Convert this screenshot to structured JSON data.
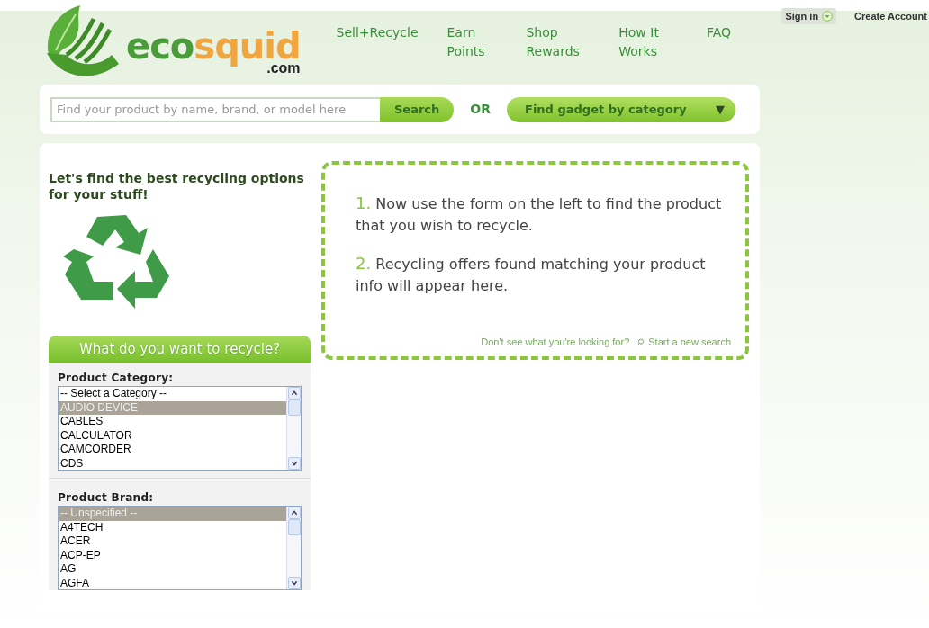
{
  "account": {
    "sign_in": "Sign in",
    "create_account": "Create Account"
  },
  "logo": {
    "word_first": "eco",
    "word_second": "squid",
    "domain": ".com"
  },
  "nav": [
    {
      "label": "Sell+Recycle"
    },
    {
      "label": "Earn Points"
    },
    {
      "label": "Shop Rewards"
    },
    {
      "label": "How It Works"
    },
    {
      "label": "FAQ"
    }
  ],
  "search": {
    "placeholder": "Find your product by name, brand, or model here",
    "button": "Search",
    "or": "OR",
    "category_button": "Find gadget by category",
    "category_caret": "▼"
  },
  "intro": {
    "heading": "Let's find the best recycling options for your stuff!"
  },
  "steps": [
    {
      "number": "1.",
      "text": "Now use the form on the left to find the product that you wish to recycle."
    },
    {
      "number": "2.",
      "text": "Recycling offers found matching your product info will appear here."
    }
  ],
  "help": {
    "question": "Don't see what you're looking for?",
    "link": "Start a new search"
  },
  "form": {
    "title": "What do you want to recycle?",
    "lists": [
      {
        "label": "Product Category:",
        "options": [
          {
            "text": "-- Select a Category --",
            "selected": false
          },
          {
            "text": "AUDIO DEVICE",
            "selected": true
          },
          {
            "text": "CABLES",
            "selected": false
          },
          {
            "text": "CALCULATOR",
            "selected": false
          },
          {
            "text": "CAMCORDER",
            "selected": false
          },
          {
            "text": "CDS",
            "selected": false
          }
        ]
      },
      {
        "label": "Product Brand:",
        "options": [
          {
            "text": "-- Unspecified --",
            "selected": true
          },
          {
            "text": "A4TECH",
            "selected": false
          },
          {
            "text": "ACER",
            "selected": false
          },
          {
            "text": "ACP-EP",
            "selected": false
          },
          {
            "text": "AG",
            "selected": false
          },
          {
            "text": "AGFA",
            "selected": false
          }
        ]
      }
    ]
  }
}
